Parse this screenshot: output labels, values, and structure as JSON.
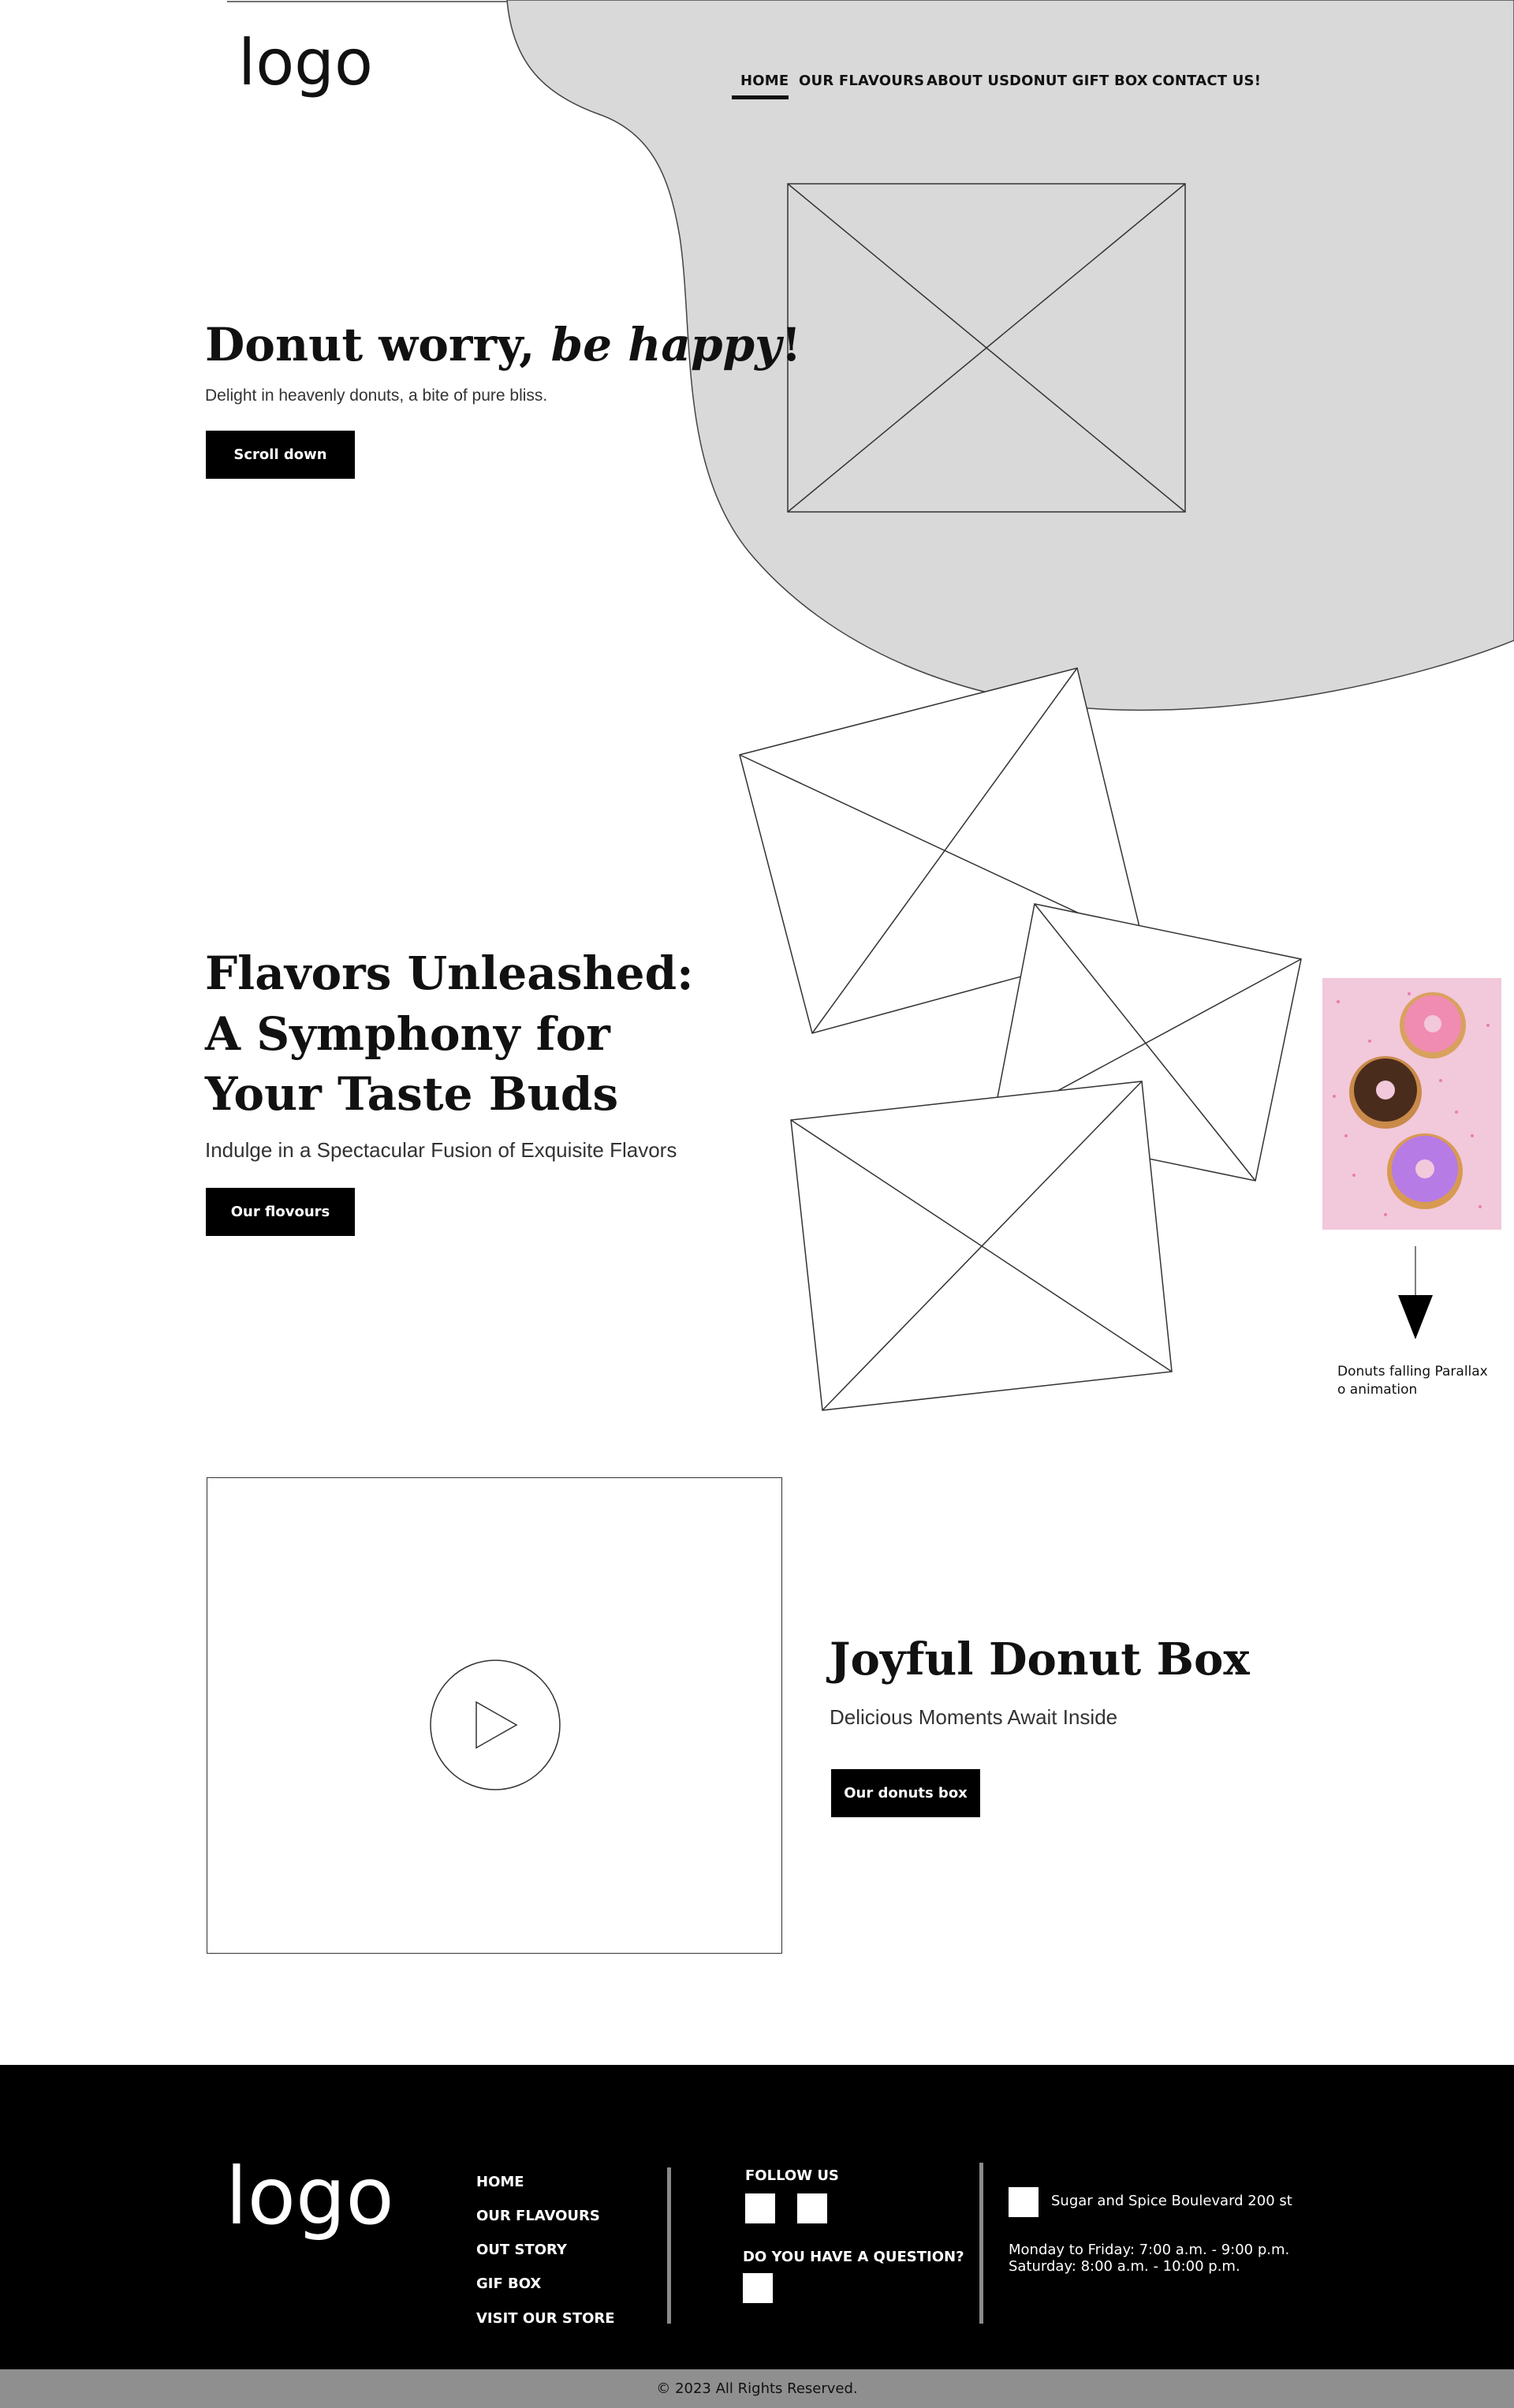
{
  "header": {
    "logo": "logo",
    "nav": [
      "HOME",
      "OUR FLAVOURS",
      "ABOUT US",
      "DONUT GIFT BOX",
      "CONTACT US!"
    ],
    "active_nav": "HOME"
  },
  "hero": {
    "title_main": "Donut worry, ",
    "title_italic": "be happy",
    "title_end": "!",
    "subtitle": "Delight in heavenly donuts, a bite of pure bliss.",
    "button": "Scroll down"
  },
  "flavors": {
    "title": "Flavors Unleashed: A Symphony for Your Taste Buds",
    "subtitle": "Indulge in a Spectacular Fusion of Exquisite Flavors",
    "button": "Our flovours",
    "annotation": [
      "Donuts falling Parallax",
      "o animation"
    ]
  },
  "donut_box": {
    "title": "Joyful Donut Box",
    "subtitle": "Delicious Moments Await Inside",
    "button": "Our donuts box"
  },
  "footer": {
    "logo": "logo",
    "links": [
      "HOME",
      "OUR FLAVOURS",
      "OUT STORY",
      "GIF BOX",
      "VISIT OUR STORE"
    ],
    "follow_us": "FOLLOW US",
    "question": "DO YOU HAVE A QUESTION?",
    "address": "Sugar and Spice Boulevard 200 st",
    "hours_weekday": "Monday to Friday: 7:00 a.m. - 9:00 p.m.",
    "hours_saturday": "Saturday: 8:00 a.m. - 10:00 p.m.",
    "copyright": "© 2023  All Rights Reserved."
  },
  "colors": {
    "blob": "#d9d9d9",
    "footer": "#000000",
    "bottom_bar": "#8f8f8f",
    "button": "#000000"
  }
}
